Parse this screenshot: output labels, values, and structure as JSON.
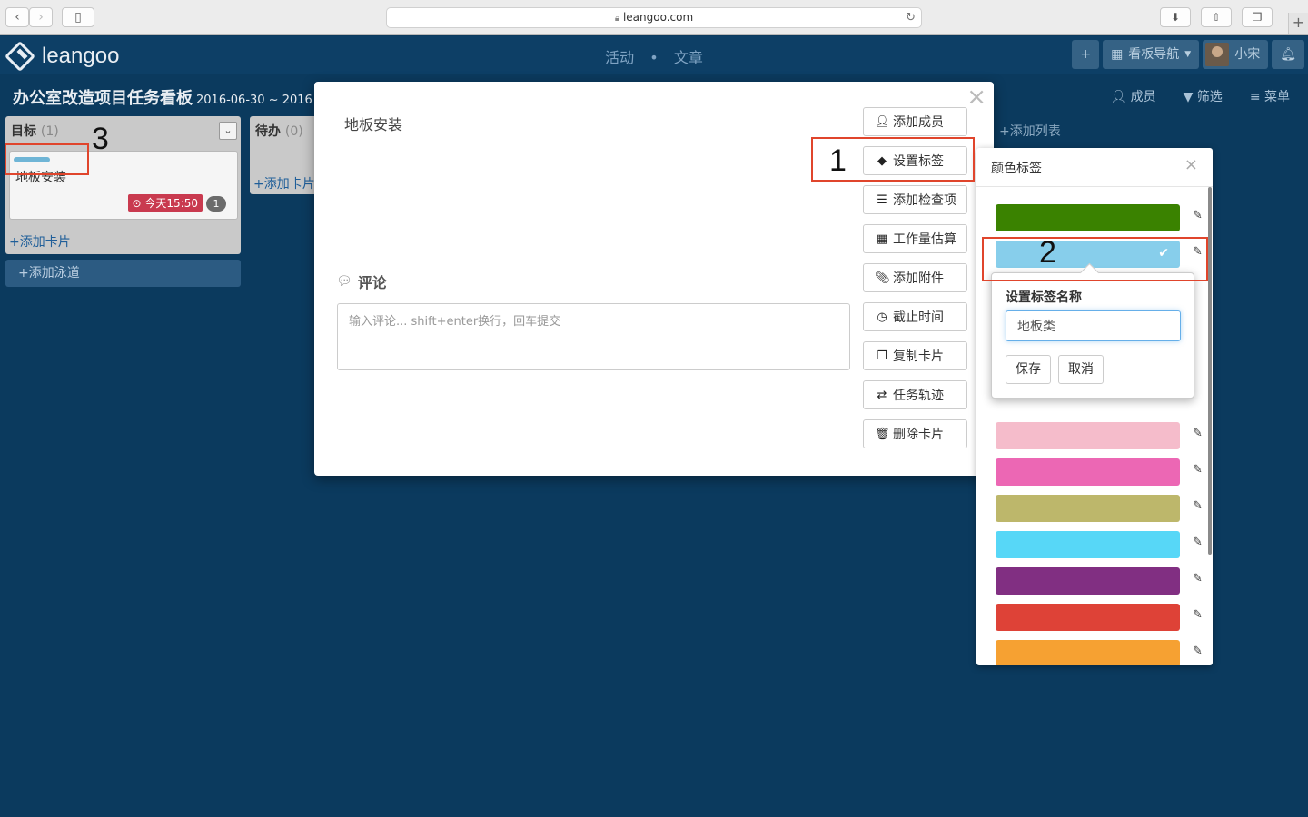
{
  "browser": {
    "url": "leangoo.com",
    "lock_icon": "lock-icon",
    "reload_icon": "reload-icon"
  },
  "app": {
    "logo": "leangoo",
    "nav": {
      "activity": "活动",
      "separator": "•",
      "articles": "文章"
    },
    "header_buttons": {
      "add": "+",
      "board_nav": "看板导航",
      "user": "小宋"
    }
  },
  "board": {
    "title": "办公室改造项目任务看板",
    "dates": "2016-06-30 ~ 2016",
    "tools": {
      "members": "成员",
      "filter": "筛选",
      "menu": "菜单"
    },
    "lists": [
      {
        "title": "目标",
        "count": "(1)",
        "cards": [
          {
            "title": "地板安装",
            "label_color": "#6fb5d6",
            "due": "今天15:50",
            "comments": "1"
          }
        ],
        "add_card": "添加卡片"
      },
      {
        "title": "待办",
        "count": "(0)",
        "add_card": "添加卡片"
      }
    ],
    "add_lane": "添加泳道",
    "add_list": "添加列表"
  },
  "modal": {
    "card_title": "地板安装",
    "close": "×",
    "comment_heading": "评论",
    "comment_placeholder": "输入评论... shift+enter换行，回车提交",
    "actions": [
      {
        "label": "添加成员",
        "icon": "add-user-icon"
      },
      {
        "label": "设置标签",
        "icon": "tag-icon"
      },
      {
        "label": "添加检查项",
        "icon": "checklist-icon"
      },
      {
        "label": "工作量估算",
        "icon": "grid-icon"
      },
      {
        "label": "添加附件",
        "icon": "paperclip-icon"
      },
      {
        "label": "截止时间",
        "icon": "clock-icon"
      },
      {
        "label": "复制卡片",
        "icon": "copy-icon"
      },
      {
        "label": "任务轨迹",
        "icon": "exchange-icon"
      },
      {
        "label": "删除卡片",
        "icon": "trash-icon"
      }
    ]
  },
  "tag_panel": {
    "title": "颜色标签",
    "close": "×",
    "colors": [
      "#3a8200",
      "#87ceeb",
      "#f5bccb",
      "#ec67b4",
      "#bdb76b",
      "#57d7f7",
      "#812f82",
      "#de4237",
      "#f6a132"
    ],
    "selected_index": 1
  },
  "rename_popover": {
    "title": "设置标签名称",
    "value": "地板类",
    "save": "保存",
    "cancel": "取消"
  },
  "annotations": {
    "step1": "1",
    "step2": "2",
    "step3": "3",
    "color": "#e0452c"
  }
}
